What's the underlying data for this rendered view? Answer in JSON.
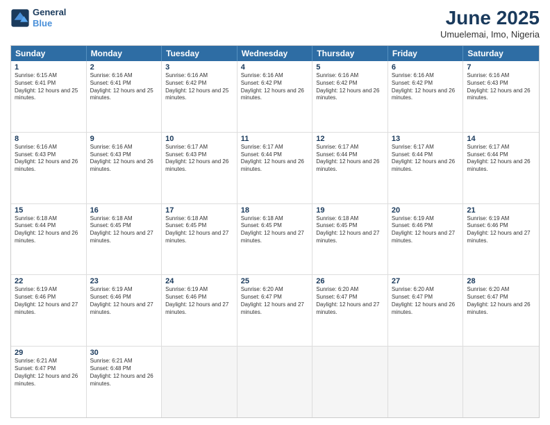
{
  "logo": {
    "line1": "General",
    "line2": "Blue"
  },
  "title": "June 2025",
  "location": "Umuelemai, Imo, Nigeria",
  "days": [
    "Sunday",
    "Monday",
    "Tuesday",
    "Wednesday",
    "Thursday",
    "Friday",
    "Saturday"
  ],
  "weeks": [
    [
      {
        "day": "1",
        "rise": "6:15 AM",
        "set": "6:41 PM",
        "daylight": "12 hours and 25 minutes."
      },
      {
        "day": "2",
        "rise": "6:16 AM",
        "set": "6:41 PM",
        "daylight": "12 hours and 25 minutes."
      },
      {
        "day": "3",
        "rise": "6:16 AM",
        "set": "6:42 PM",
        "daylight": "12 hours and 25 minutes."
      },
      {
        "day": "4",
        "rise": "6:16 AM",
        "set": "6:42 PM",
        "daylight": "12 hours and 26 minutes."
      },
      {
        "day": "5",
        "rise": "6:16 AM",
        "set": "6:42 PM",
        "daylight": "12 hours and 26 minutes."
      },
      {
        "day": "6",
        "rise": "6:16 AM",
        "set": "6:42 PM",
        "daylight": "12 hours and 26 minutes."
      },
      {
        "day": "7",
        "rise": "6:16 AM",
        "set": "6:43 PM",
        "daylight": "12 hours and 26 minutes."
      }
    ],
    [
      {
        "day": "8",
        "rise": "6:16 AM",
        "set": "6:43 PM",
        "daylight": "12 hours and 26 minutes."
      },
      {
        "day": "9",
        "rise": "6:16 AM",
        "set": "6:43 PM",
        "daylight": "12 hours and 26 minutes."
      },
      {
        "day": "10",
        "rise": "6:17 AM",
        "set": "6:43 PM",
        "daylight": "12 hours and 26 minutes."
      },
      {
        "day": "11",
        "rise": "6:17 AM",
        "set": "6:44 PM",
        "daylight": "12 hours and 26 minutes."
      },
      {
        "day": "12",
        "rise": "6:17 AM",
        "set": "6:44 PM",
        "daylight": "12 hours and 26 minutes."
      },
      {
        "day": "13",
        "rise": "6:17 AM",
        "set": "6:44 PM",
        "daylight": "12 hours and 26 minutes."
      },
      {
        "day": "14",
        "rise": "6:17 AM",
        "set": "6:44 PM",
        "daylight": "12 hours and 26 minutes."
      }
    ],
    [
      {
        "day": "15",
        "rise": "6:18 AM",
        "set": "6:44 PM",
        "daylight": "12 hours and 26 minutes."
      },
      {
        "day": "16",
        "rise": "6:18 AM",
        "set": "6:45 PM",
        "daylight": "12 hours and 27 minutes."
      },
      {
        "day": "17",
        "rise": "6:18 AM",
        "set": "6:45 PM",
        "daylight": "12 hours and 27 minutes."
      },
      {
        "day": "18",
        "rise": "6:18 AM",
        "set": "6:45 PM",
        "daylight": "12 hours and 27 minutes."
      },
      {
        "day": "19",
        "rise": "6:18 AM",
        "set": "6:45 PM",
        "daylight": "12 hours and 27 minutes."
      },
      {
        "day": "20",
        "rise": "6:19 AM",
        "set": "6:46 PM",
        "daylight": "12 hours and 27 minutes."
      },
      {
        "day": "21",
        "rise": "6:19 AM",
        "set": "6:46 PM",
        "daylight": "12 hours and 27 minutes."
      }
    ],
    [
      {
        "day": "22",
        "rise": "6:19 AM",
        "set": "6:46 PM",
        "daylight": "12 hours and 27 minutes."
      },
      {
        "day": "23",
        "rise": "6:19 AM",
        "set": "6:46 PM",
        "daylight": "12 hours and 27 minutes."
      },
      {
        "day": "24",
        "rise": "6:19 AM",
        "set": "6:46 PM",
        "daylight": "12 hours and 27 minutes."
      },
      {
        "day": "25",
        "rise": "6:20 AM",
        "set": "6:47 PM",
        "daylight": "12 hours and 27 minutes."
      },
      {
        "day": "26",
        "rise": "6:20 AM",
        "set": "6:47 PM",
        "daylight": "12 hours and 27 minutes."
      },
      {
        "day": "27",
        "rise": "6:20 AM",
        "set": "6:47 PM",
        "daylight": "12 hours and 26 minutes."
      },
      {
        "day": "28",
        "rise": "6:20 AM",
        "set": "6:47 PM",
        "daylight": "12 hours and 26 minutes."
      }
    ],
    [
      {
        "day": "29",
        "rise": "6:21 AM",
        "set": "6:47 PM",
        "daylight": "12 hours and 26 minutes."
      },
      {
        "day": "30",
        "rise": "6:21 AM",
        "set": "6:48 PM",
        "daylight": "12 hours and 26 minutes."
      },
      null,
      null,
      null,
      null,
      null
    ]
  ]
}
